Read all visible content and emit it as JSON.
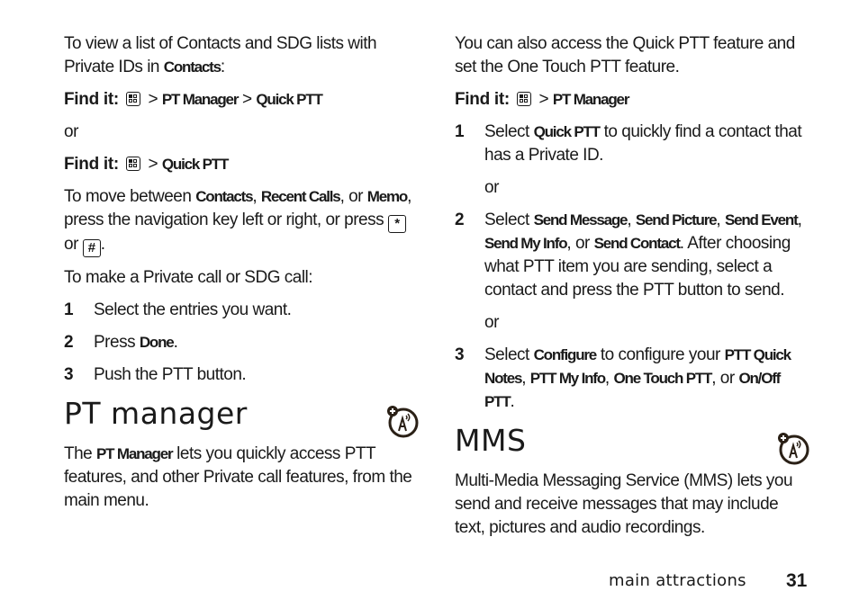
{
  "left_column": {
    "intro": {
      "text_before": "To view a list of Contacts and SDG lists with Private IDs in ",
      "ui": "Contacts",
      "text_after": ":"
    },
    "find_it_1": {
      "label": "Find it:",
      "menu_icon": "menu-key-icon",
      "path": [
        ">",
        "PT Manager",
        ">",
        "Quick PTT"
      ]
    },
    "or_1": "or",
    "find_it_2": {
      "label": "Find it:",
      "menu_icon": "menu-key-icon",
      "path": [
        ">",
        "Quick PTT"
      ]
    },
    "move_para": {
      "t1": "To move between ",
      "ui1": "Contacts",
      "t2": ", ",
      "ui2": "Recent Calls",
      "t3": ", or ",
      "ui3": "Memo",
      "t4": ", press the navigation key left or right, or press ",
      "key1": "*",
      "t5": " or ",
      "key2": "#",
      "t6": "."
    },
    "call_intro": "To make a Private call or SDG call:",
    "steps": [
      {
        "num": "1",
        "text": "Select the entries you want."
      },
      {
        "num": "2",
        "text_before": "Press ",
        "ui": "Done",
        "text_after": "."
      },
      {
        "num": "3",
        "text": "Push the PTT button."
      }
    ],
    "section": {
      "title": "PT manager",
      "icon": "network-feature-icon",
      "body_before": "The ",
      "body_ui": "PT Manager",
      "body_after": " lets you quickly access PTT features, and other Private call features, from the main menu."
    }
  },
  "right_column": {
    "intro": "You can also access the Quick PTT feature and set the One Touch PTT feature.",
    "find_it": {
      "label": "Find it:",
      "menu_icon": "menu-key-icon",
      "path": [
        ">",
        "PT Manager"
      ]
    },
    "steps": [
      {
        "num": "1",
        "t1": "Select ",
        "ui1": "Quick PTT",
        "t2": " to quickly find a contact that has a Private ID."
      },
      {
        "num": "2",
        "t1": "Select ",
        "ui1": "Send Message",
        "t2": ", ",
        "ui2": "Send Picture",
        "t3": ", ",
        "ui3": "Send Event",
        "t4": ", ",
        "ui4": "Send My Info",
        "t5": ", or ",
        "ui5": "Send Contact",
        "t6": ". After choosing what PTT item you are sending, select a contact and press the PTT button to send."
      },
      {
        "num": "3",
        "t1": "Select ",
        "ui1": "Configure",
        "t2": " to configure your ",
        "ui2": "PTT Quick Notes",
        "t3": ", ",
        "ui3": "PTT My Info",
        "t4": ", ",
        "ui4": "One Touch PTT",
        "t5": ", or ",
        "ui5": "On/Off PTT",
        "t6": "."
      }
    ],
    "or_1": "or",
    "or_2": "or",
    "section": {
      "title": "MMS",
      "icon": "network-feature-icon",
      "body": "Multi-Media Messaging Service (MMS) lets you send and receive messages that may include text, pictures and audio recordings."
    }
  },
  "footer": {
    "label": "main attractions",
    "page_number": "31"
  }
}
